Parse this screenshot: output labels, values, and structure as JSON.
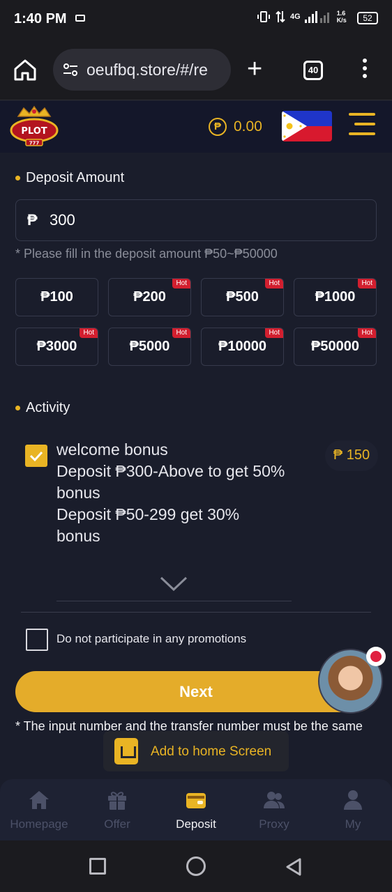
{
  "status": {
    "time": "1:40 PM",
    "net": "4G",
    "speed": "1.6\nK/s",
    "battery": "52"
  },
  "browser": {
    "url": "oeufbq.store/#/re",
    "tab_count": "40"
  },
  "header": {
    "logo_text": "PLOT",
    "logo_sub": "777",
    "balance": "0.00",
    "coin_symbol": "₱"
  },
  "deposit": {
    "title": "Deposit Amount",
    "currency": "₱",
    "amount": "300",
    "hint": "* Please fill in the deposit amount ₱50~₱50000",
    "options": [
      {
        "label": "₱100",
        "hot": ""
      },
      {
        "label": "₱200",
        "hot": "Hot"
      },
      {
        "label": "₱500",
        "hot": "Hot"
      },
      {
        "label": "₱1000",
        "hot": "Hot"
      },
      {
        "label": "₱3000",
        "hot": "Hot"
      },
      {
        "label": "₱5000",
        "hot": "Hot"
      },
      {
        "label": "₱10000",
        "hot": "Hot"
      },
      {
        "label": "₱50000",
        "hot": "Hot"
      }
    ]
  },
  "activity": {
    "title": "Activity",
    "bonus_name": "welcome bonus",
    "bonus_line1": "Deposit ₱300-Above to get 50% bonus",
    "bonus_line2": "Deposit ₱50-299 get 30% bonus",
    "bonus_amount": "₱ 150",
    "no_promo": "Do not participate in any promotions"
  },
  "next_label": "Next",
  "note": "* The input number and the transfer number must be the same",
  "toast": "Add to home Screen",
  "tabs": [
    {
      "label": "Homepage",
      "icon": "home-icon"
    },
    {
      "label": "Offer",
      "icon": "gift-icon"
    },
    {
      "label": "Deposit",
      "icon": "wallet-icon"
    },
    {
      "label": "Proxy",
      "icon": "users-icon"
    },
    {
      "label": "My",
      "icon": "user-icon"
    }
  ],
  "colors": {
    "accent": "#e9b424",
    "button": "#e4ac2a",
    "hot": "#d21f2f",
    "bg": "#1a1d2b"
  }
}
